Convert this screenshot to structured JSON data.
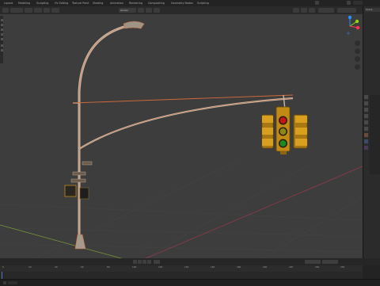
{
  "topbar": {
    "tabs": [
      "Layout",
      "Modeling",
      "Sculpting",
      "UV Editing",
      "Texture Paint",
      "Shading",
      "Animation",
      "Rendering",
      "Compositing",
      "Geometry Nodes",
      "Scripting"
    ]
  },
  "viewport_header": {
    "mode_label": "Global"
  },
  "outliner": {
    "label": "Scene"
  },
  "timeline": {
    "ticks": [
      "0",
      "20",
      "40",
      "60",
      "80",
      "100",
      "120",
      "140",
      "160",
      "180",
      "200",
      "220",
      "240",
      "250"
    ]
  },
  "colors": {
    "viewport_bg": "#3d3d3d",
    "pole": "#c8b9a8",
    "wire": "#d46a3a",
    "signal_housing": "#c08a14",
    "red_light": "#c41616",
    "yellow_light": "#8a8a10",
    "green_light": "#1c8a1c",
    "x_axis": "#ff3352",
    "y_axis": "#8bdc00",
    "z_axis": "#2890ff",
    "keyframe_marker": "#e69a28"
  },
  "icons": [
    "cursor-icon",
    "move-icon",
    "rotate-icon",
    "scale-icon",
    "transform-icon",
    "annotate-icon",
    "measure-icon",
    "zoom-icon",
    "hand-icon",
    "camera-icon",
    "grid-icon",
    "play-icon",
    "stop-icon",
    "jump-start-icon",
    "jump-end-icon"
  ]
}
